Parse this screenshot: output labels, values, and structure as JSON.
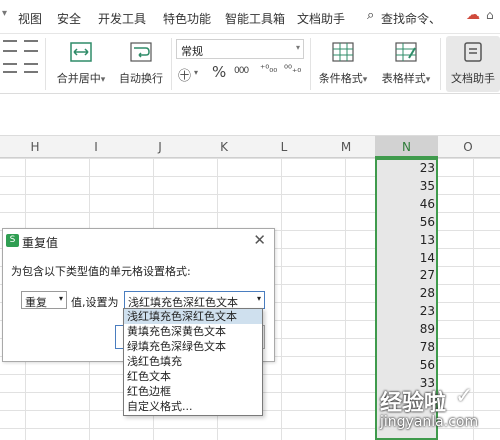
{
  "menu": {
    "items": [
      "视图",
      "安全",
      "开发工具",
      "特色功能",
      "智能工具箱",
      "文档助手"
    ],
    "search_placeholder": "查找命令、"
  },
  "ribbon": {
    "merge_center": "合并居中",
    "merge_center_arrow": "▾",
    "wrap_text": "自动换行",
    "number_format": "常规",
    "currency_symbol": "㊉",
    "percent_symbol": "%",
    "comma_symbol": "000",
    "dec_increase": "⁺⁰₀₀",
    "dec_decrease": "⁰⁰₊₀",
    "conditional_format": "条件格式",
    "table_style": "表格样式",
    "doc_assistant": "文档助手"
  },
  "columns": [
    "H",
    "I",
    "J",
    "K",
    "L",
    "M",
    "N",
    "O"
  ],
  "column_n_values": [
    "23",
    "35",
    "46",
    "56",
    "13",
    "14",
    "27",
    "28",
    "23",
    "89",
    "78",
    "56",
    "33"
  ],
  "dialog": {
    "title": "重复值",
    "prompt": "为包含以下类型值的单元格设置格式:",
    "type_value": "重复",
    "value_label": "值,设置为",
    "format_value": "浅红填充色深红色文本"
  },
  "dropdown_options": [
    "浅红填充色深红色文本",
    "黄填充色深黄色文本",
    "绿填充色深绿色文本",
    "浅红色填充",
    "红色文本",
    "红色边框",
    "自定义格式..."
  ],
  "watermark": {
    "line1": "经验啦",
    "line2": "jingyanla.com",
    "check": "✓"
  },
  "colors": {
    "accent_green": "#3f9a4c",
    "selected_column": "#e7e7e7",
    "highlight": "#cfe0ee"
  }
}
